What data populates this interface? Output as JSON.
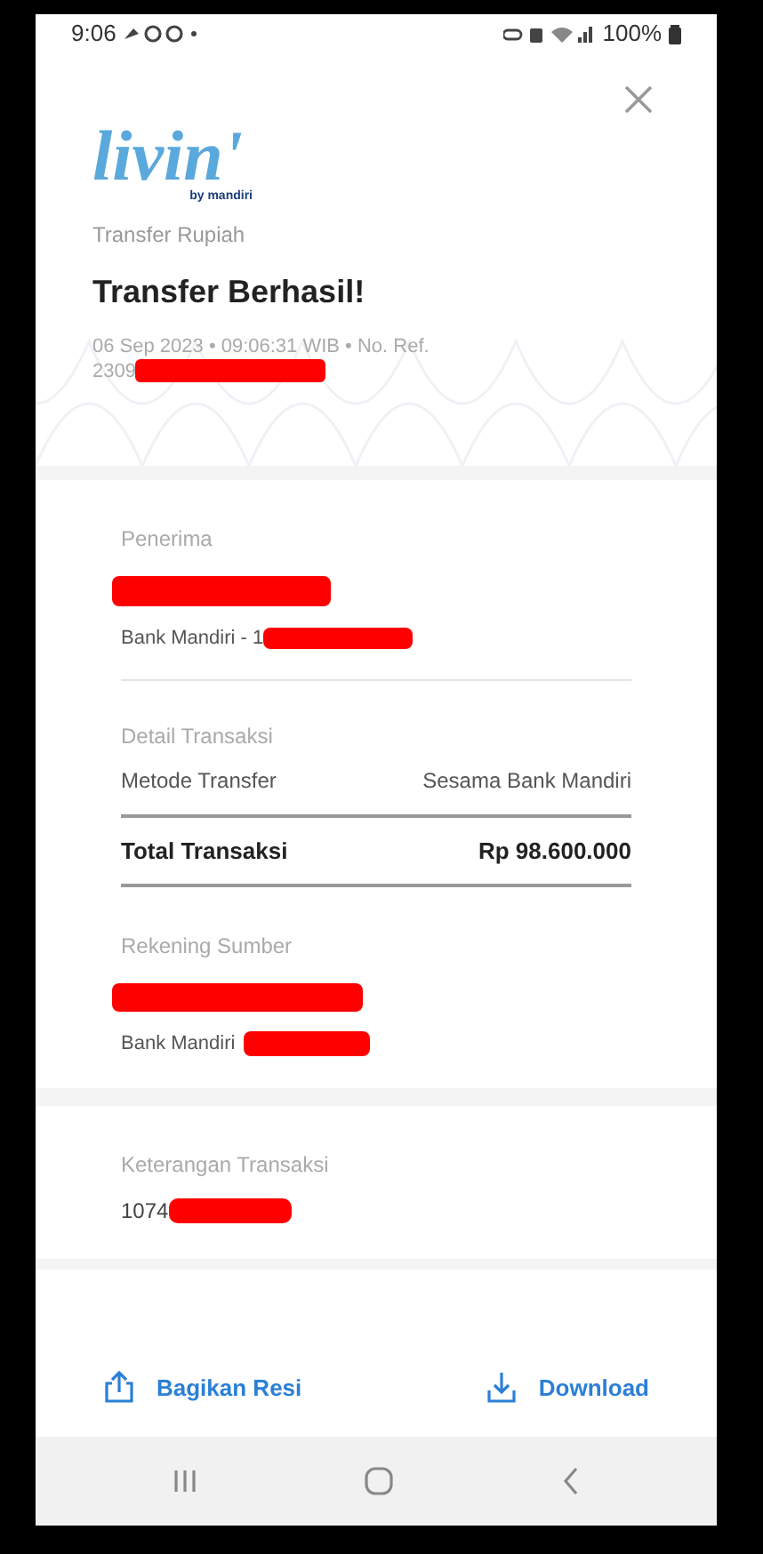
{
  "status_bar": {
    "time": "9:06",
    "battery": "100%"
  },
  "header": {
    "logo": {
      "wordmark": "livin'",
      "byline": "by mandiri"
    },
    "subtitle": "Transfer Rupiah",
    "title": "Transfer Berhasil!",
    "meta": "06 Sep 2023 • 09:06:31 WIB • No. Ref.",
    "reference": "2309"
  },
  "recipient": {
    "label": "Penerima",
    "bank": "Bank Mandiri - 1"
  },
  "details": {
    "label": "Detail Transaksi",
    "rows": [
      {
        "kind": "normal",
        "name": "Metode Transfer",
        "value": "Sesama Bank Mandiri"
      },
      {
        "kind": "total",
        "name": "Total Transaksi",
        "value": "Rp 98.600.000"
      }
    ]
  },
  "source": {
    "label": "Rekening Sumber",
    "bank": "Bank Mandiri"
  },
  "note": {
    "label": "Keterangan Transaksi",
    "value": "1074"
  },
  "actions": [
    {
      "kind": "share",
      "label": "Bagikan Resi"
    },
    {
      "kind": "download",
      "label": "Download"
    }
  ]
}
